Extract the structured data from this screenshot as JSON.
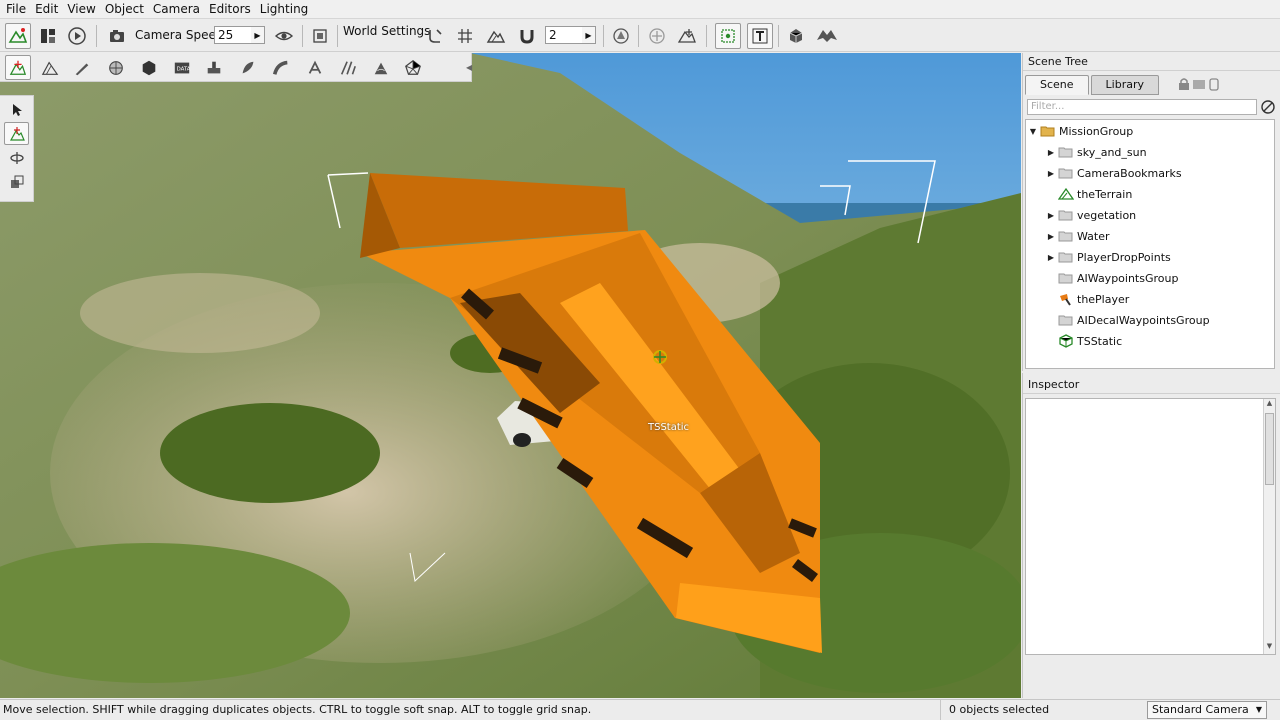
{
  "menu": [
    "File",
    "Edit",
    "View",
    "Object",
    "Camera",
    "Editors",
    "Lighting"
  ],
  "toolbar": {
    "camera_speed_label": "Camera Speed",
    "camera_speed_value": "25",
    "world_settings_label": "World Settings",
    "snap_value": "2"
  },
  "viewport": {
    "selected_object_label": "TSStatic"
  },
  "scene_panel": {
    "title": "Scene Tree",
    "tabs": [
      "Scene",
      "Library"
    ],
    "filter_placeholder": "Filter...",
    "items": [
      {
        "label": "MissionGroup",
        "icon": "folder-open-icon"
      },
      {
        "label": "sky_and_sun",
        "icon": "folder-icon"
      },
      {
        "label": "CameraBookmarks",
        "icon": "folder-icon"
      },
      {
        "label": "theTerrain",
        "icon": "terrain-icon"
      },
      {
        "label": "vegetation",
        "icon": "folder-icon"
      },
      {
        "label": "Water",
        "icon": "folder-icon"
      },
      {
        "label": "PlayerDropPoints",
        "icon": "folder-icon"
      },
      {
        "label": "AIWaypointsGroup",
        "icon": "folder-icon"
      },
      {
        "label": "thePlayer",
        "icon": "player-icon"
      },
      {
        "label": "AIDecalWaypointsGroup",
        "icon": "folder-icon"
      },
      {
        "label": "TSStatic",
        "icon": "tsstatic-icon"
      }
    ]
  },
  "inspector": {
    "title": "Inspector"
  },
  "status": {
    "message": "Move selection.  SHIFT while dragging duplicates objects.  CTRL to toggle soft snap.  ALT to toggle grid snap.",
    "selection": "0 objects selected",
    "camera_mode": "Standard Camera"
  },
  "colors": {
    "object_orange": "#f08a10",
    "sky": "#79b6e0",
    "terrain_green": "#6f8644"
  }
}
